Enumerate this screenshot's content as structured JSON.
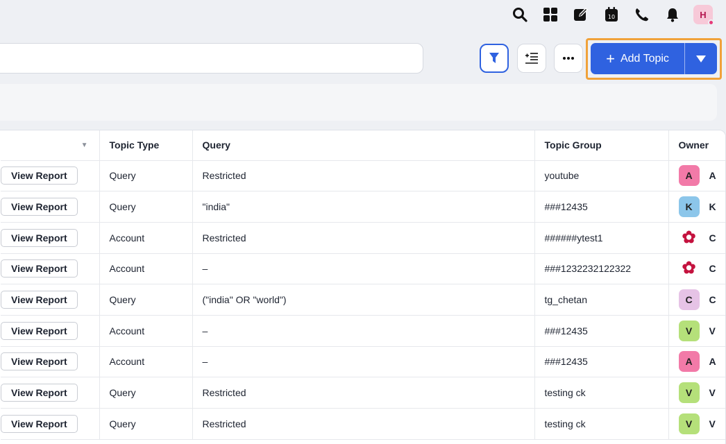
{
  "header": {
    "icons": [
      "search-icon",
      "apps-grid-icon",
      "compose-icon",
      "calendar-icon",
      "phone-icon",
      "bell-icon"
    ],
    "calendar_day": "10",
    "user_initial": "H"
  },
  "toolbar": {
    "add_label": "Add Topic"
  },
  "table": {
    "headers": {
      "topic_type": "Topic Type",
      "query": "Query",
      "topic_group": "Topic Group",
      "owner": "Owner"
    },
    "view_report_label": "View Report",
    "rows": [
      {
        "topic_type": "Query",
        "query": "Restricted",
        "topic_group": "youtube",
        "owner_initial": "A",
        "owner_name": "A",
        "owner_color": "#f27aa8"
      },
      {
        "topic_type": "Query",
        "query": "\"india\"",
        "topic_group": "###12435",
        "owner_initial": "K",
        "owner_name": "K",
        "owner_color": "#8cc6ea"
      },
      {
        "topic_type": "Account",
        "query": "Restricted",
        "topic_group": "######ytest1",
        "owner_initial": "",
        "owner_name": "C",
        "owner_color": "flower"
      },
      {
        "topic_type": "Account",
        "query": "–",
        "topic_group": "###1232232122322",
        "owner_initial": "",
        "owner_name": "C",
        "owner_color": "flower"
      },
      {
        "topic_type": "Query",
        "query": "(\"india\" OR \"world\")",
        "topic_group": "tg_chetan",
        "owner_initial": "C",
        "owner_name": "C",
        "owner_color": "#e6c3e6"
      },
      {
        "topic_type": "Account",
        "query": "–",
        "topic_group": "###12435",
        "owner_initial": "V",
        "owner_name": "V",
        "owner_color": "#b5e07a"
      },
      {
        "topic_type": "Account",
        "query": "–",
        "topic_group": "###12435",
        "owner_initial": "A",
        "owner_name": "A",
        "owner_color": "#f27aa8"
      },
      {
        "topic_type": "Query",
        "query": "Restricted",
        "topic_group": "testing ck",
        "owner_initial": "V",
        "owner_name": "V",
        "owner_color": "#b5e07a"
      },
      {
        "topic_type": "Query",
        "query": "Restricted",
        "topic_group": "testing ck",
        "owner_initial": "V",
        "owner_name": "V",
        "owner_color": "#b5e07a"
      }
    ]
  },
  "colors": {
    "accent": "#2f62e0",
    "highlight": "#f0a23a"
  }
}
